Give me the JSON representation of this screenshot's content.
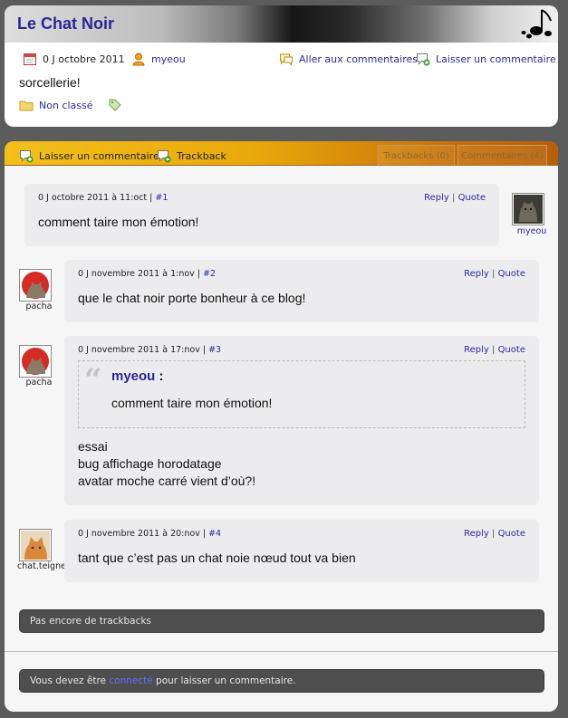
{
  "post": {
    "title": "Le Chat Noir",
    "date": "0 J octobre 2011",
    "author": "myeou",
    "goto_comments": "Aller aux commentaires",
    "leave_comment": "Laisser un commentaire",
    "body": "sorcellerie!",
    "category": "Non classé"
  },
  "comments_bar": {
    "leave_comment": "Laisser un commentaire",
    "trackback": "Trackback",
    "tab_trackbacks": "Trackbacks (0)",
    "tab_comments": "Commentaires (4)"
  },
  "comments": [
    {
      "date": "0 J octobre 2011 à 11:oct",
      "sep": "|",
      "num": "#1",
      "reply": "Reply",
      "quote": "Quote",
      "text": "comment taire mon émotion!",
      "author": "myeou"
    },
    {
      "date": "0 J novembre 2011 à 1:nov",
      "sep": "|",
      "num": "#2",
      "reply": "Reply",
      "quote": "Quote",
      "text": "que le chat noir porte bonheur à ce blog!",
      "author": "pacha"
    },
    {
      "date": "0 J novembre 2011 à 17:nov",
      "sep": "|",
      "num": "#3",
      "reply": "Reply",
      "quote": "Quote",
      "quote_author": "myeou",
      "quote_colon": ":",
      "quote_text": "comment taire mon émotion!",
      "lines": [
        "essai",
        "bug affichage horodatage",
        "avatar moche carré vient d’où?!"
      ],
      "author": "pacha"
    },
    {
      "date": "0 J novembre 2011 à 20:nov",
      "sep": "|",
      "num": "#4",
      "reply": "Reply",
      "quote": "Quote",
      "text": "tant que c’est pas un chat noie nœud tout va bien",
      "author": "chat.teigne"
    }
  ],
  "actions_sep": "|",
  "no_trackbacks": "Pas encore de trackbacks",
  "login_notice": {
    "before": "Vous devez être",
    "link": "connecté",
    "after": "pour laisser un commentaire."
  },
  "colors": {
    "title_blue": "#2b2596",
    "link_blue": "#2a2aa0",
    "bar_orange": "#e8a90c",
    "bubble_grey": "#ececee",
    "dark_bar": "#4e4e4e"
  },
  "icons": [
    "music-note-icon",
    "calendar-icon",
    "user-icon",
    "comment-bubble-icon",
    "add-comment-icon",
    "folder-icon",
    "tag-icon",
    "trackback-icon",
    "quote-mark-icon"
  ]
}
